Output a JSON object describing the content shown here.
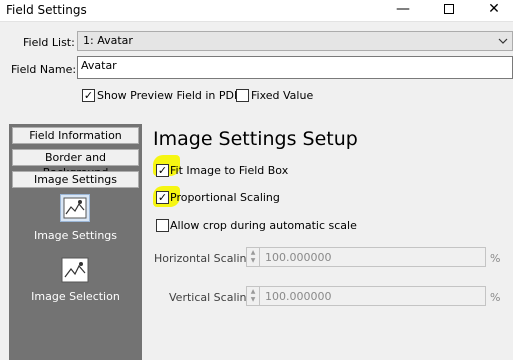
{
  "window": {
    "title": "Field Settings",
    "minimize": "—",
    "close": "✕"
  },
  "field_list": {
    "label": "Field List:",
    "value": "1: Avatar"
  },
  "field_name": {
    "label": "Field Name:",
    "value": "Avatar"
  },
  "options": {
    "show_preview": {
      "label": "Show Preview Field in PDF",
      "checked": true
    },
    "fixed_value": {
      "label": "Fixed Value",
      "checked": false
    }
  },
  "sidebar": {
    "buttons": [
      "Field Information",
      "Border and Background",
      "Image Settings"
    ],
    "icons": [
      {
        "label": "Image Settings",
        "icon": "image-settings-icon"
      },
      {
        "label": "Image Selection",
        "icon": "image-selection-icon"
      }
    ]
  },
  "panel": {
    "heading": "Image Settings Setup",
    "fit_image": {
      "label": "Fit Image to Field Box",
      "checked": true
    },
    "proportional": {
      "label": "Proportional Scaling",
      "checked": true
    },
    "allow_crop": {
      "label": "Allow crop during automatic scale",
      "checked": false
    },
    "horizontal": {
      "label": "Horizontal Scaling:",
      "value": "100.000000",
      "unit": "%"
    },
    "vertical": {
      "label": "Vertical Scaling:",
      "value": "100.000000",
      "unit": "%"
    }
  },
  "colors": {
    "highlight": "#f6f612",
    "sidebar": "#737373"
  },
  "check_glyph": "✓"
}
